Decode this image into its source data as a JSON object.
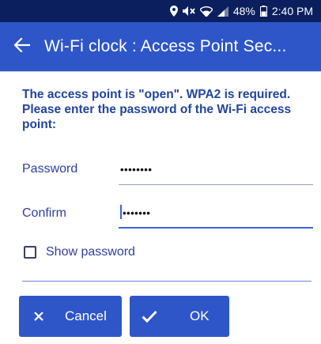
{
  "status_bar": {
    "battery": "48%",
    "time": "2:40 PM"
  },
  "app_bar": {
    "title": "Wi-Fi clock : Access Point Sec..."
  },
  "content": {
    "message": "The access point is \"open\". WPA2 is required. Please enter the password of the Wi-Fi access point:",
    "password_label": "Password",
    "password_value": "••••••••",
    "confirm_label": "Confirm",
    "confirm_value": "•••••••",
    "show_password_label": "Show password",
    "show_password_checked": false
  },
  "buttons": {
    "cancel_label": "Cancel",
    "ok_label": "OK"
  },
  "colors": {
    "status_bar": "#0b1f5e",
    "app_bar": "#2f56c8",
    "text_blue": "#23449f",
    "accent": "#3d63d6"
  },
  "icons": {
    "back": "arrow-left-icon",
    "cancel": "close-icon",
    "ok": "check-icon",
    "status": [
      "location-icon",
      "mute-icon",
      "wifi-icon",
      "signal-icon",
      "battery-icon"
    ]
  }
}
